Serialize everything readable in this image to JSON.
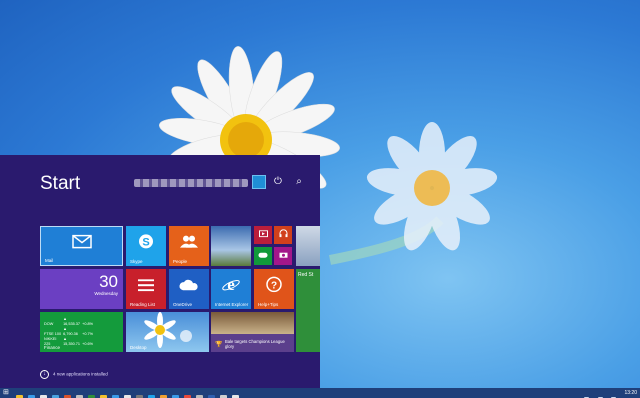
{
  "start": {
    "title": "Start",
    "power_icon": "⏻",
    "search_icon": "⌕",
    "new_apps_note": "4 new applications installed"
  },
  "tiles": {
    "mail": "Mail",
    "calendar_day": "30",
    "calendar_weekday": "Wednesday",
    "finance": "Finance",
    "finance_rows": [
      {
        "name": "DOW",
        "value": "▲ 16,535.37",
        "change": "+0.8%"
      },
      {
        "name": "FTSE 100",
        "value": "▲ 6,790.36",
        "change": "+0.7%"
      },
      {
        "name": "NIKKEI 225",
        "value": "▲ 15,350.71",
        "change": "+0.6%"
      }
    ],
    "skype": "Skype",
    "people": "People",
    "reading_list": "Reading List",
    "onedrive": "OneDrive",
    "internet_explorer": "Internet Explorer",
    "help_tips": "Help+Tips",
    "desktop": "Desktop",
    "sport_caption": "Bale targets Champions League glory",
    "red_stone": "Red St"
  },
  "taskbar": {
    "clock": "13:20",
    "app_colors": [
      "#f2c12e",
      "#3a9be8",
      "#e8e8e8",
      "#4aa3df",
      "#d9532b",
      "#c0c0c0",
      "#2f8f3a",
      "#f2c12e",
      "#3a9be8",
      "#e8e8e8",
      "#7a7a7a",
      "#1fa3ea",
      "#f0a030",
      "#3a9be8",
      "#e84a3a",
      "#bcbcbc",
      "#2f5fb0",
      "#d0d0d0",
      "#e6e6e6"
    ]
  },
  "colors": {
    "start_bg": "#2a1a6e",
    "taskbar_bg": "#1f3f7a"
  }
}
